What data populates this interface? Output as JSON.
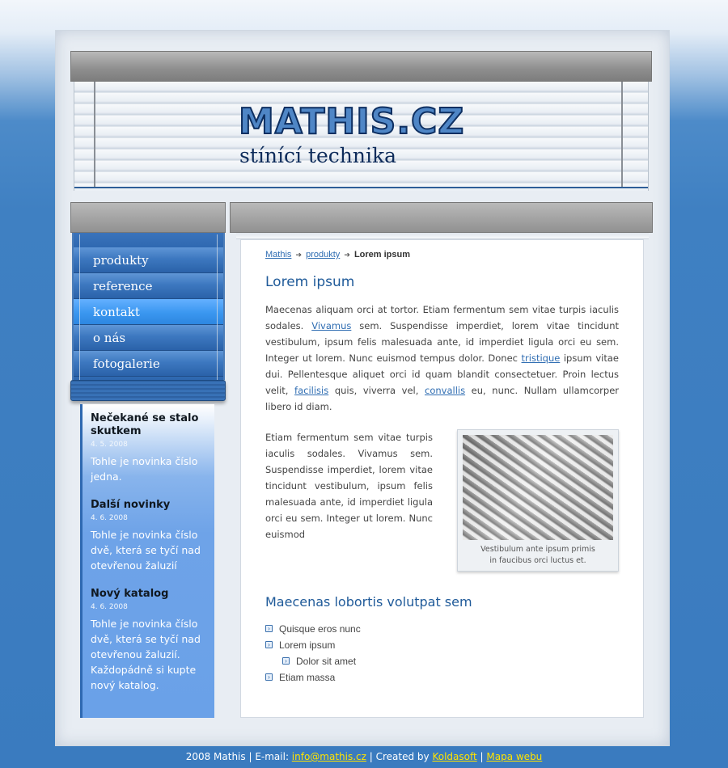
{
  "header": {
    "logo": "MATHIS.CZ",
    "tagline": "stínící technika"
  },
  "nav": {
    "items": [
      {
        "label": "produkty",
        "active": false
      },
      {
        "label": "reference",
        "active": false
      },
      {
        "label": "kontakt",
        "active": true
      },
      {
        "label": "o nás",
        "active": false
      },
      {
        "label": "fotogalerie",
        "active": false
      }
    ]
  },
  "news": [
    {
      "title": "Nečekané se stalo skutkem",
      "date": "4. 5. 2008",
      "text": "Tohle je novinka číslo jedna."
    },
    {
      "title": "Další novinky",
      "date": "4. 6. 2008",
      "text": "Tohle je novinka číslo dvě, která se tyčí nad otevřenou žaluzií"
    },
    {
      "title": "Nový katalog",
      "date": "4. 6. 2008",
      "text": "Tohle je novinka číslo dvě, která se tyčí nad otevřenou žaluzií. Každopádně si kupte nový katalog."
    }
  ],
  "breadcrumb": {
    "link1": "Mathis",
    "link2": "produkty",
    "current": "Lorem ipsum",
    "separator": "➔"
  },
  "content": {
    "title": "Lorem ipsum",
    "para1": {
      "t1": "Maecenas aliquam orci at tortor. Etiam fermentum sem vitae turpis iaculis sodales. ",
      "l1": "Vivamus",
      "t2": " sem. Suspendisse imperdiet, lorem vitae tincidunt vestibulum, ipsum felis malesuada ante, id imperdiet ligula orci eu sem. Integer ut lorem. Nunc euismod tempus dolor. Donec ",
      "l2": "tristique",
      "t3": " ipsum vitae dui. Pellentesque aliquet orci id quam blandit consectetuer. Proin lectus velit, ",
      "l3": "facilisis",
      "t4": " quis, viverra vel, ",
      "l4": "convallis",
      "t5": " eu, nunc. Nullam ullamcorper libero id diam."
    },
    "para2": "Etiam fermentum sem vitae turpis iaculis sodales. Vivamus sem. Suspendisse imperdiet, lorem vitae tincidunt vestibulum, ipsum felis malesuada ante, id imperdiet ligula orci eu sem. Integer ut lorem. Nunc euismod",
    "caption_line1": "Vestibulum ante ipsum primis",
    "caption_line2": "in faucibus orci luctus et.",
    "subtitle": "Maecenas lobortis volutpat sem",
    "list": [
      {
        "text": "Quisque eros nunc",
        "nested": false
      },
      {
        "text": "Lorem ipsum",
        "nested": false
      },
      {
        "text": "Dolor sit amet",
        "nested": true
      },
      {
        "text": "Etiam massa",
        "nested": false
      }
    ]
  },
  "footer": {
    "t1": "2008 Mathis  |  E-mail: ",
    "email": "info@mathis.cz",
    "t2": "  |  Created by ",
    "creator": "Koldasoft",
    "t3": "  |  ",
    "sitemap": "Mapa webu"
  },
  "colors": {
    "accent": "#1f5a99",
    "nav_active": "#3a97f0",
    "link": "#2f6db2",
    "footer_link": "#ffe300"
  }
}
